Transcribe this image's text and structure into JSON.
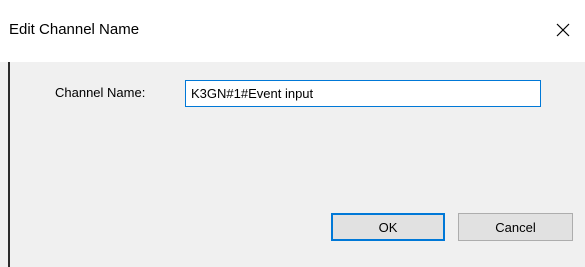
{
  "window": {
    "title": "Edit Channel Name",
    "close_icon": "close-icon"
  },
  "form": {
    "channel_name_label": "Channel Name:",
    "channel_name_value": "K3GN#1#Event input"
  },
  "buttons": {
    "ok_label": "OK",
    "cancel_label": "Cancel"
  },
  "colors": {
    "accent": "#0078d7",
    "button_face": "#e1e1e1",
    "dialog_bg": "#f0f0f0"
  }
}
